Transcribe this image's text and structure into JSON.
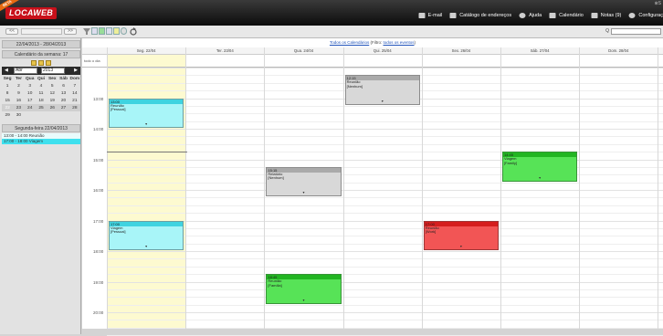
{
  "app": {
    "beta": "BETA",
    "logo": "LOCAWEB",
    "close_glyph": "⊗S"
  },
  "topnav": [
    {
      "label": "E-mail",
      "icon": "email-icon"
    },
    {
      "label": "Catálogo de endereços",
      "icon": "contacts-icon"
    },
    {
      "label": "Ajuda",
      "icon": "help-icon"
    },
    {
      "label": "Calendário",
      "icon": "calendar-icon"
    },
    {
      "label": "Notas (9)",
      "icon": "notes-icon"
    },
    {
      "label": "Configuraç",
      "icon": "gear-icon"
    }
  ],
  "toolbar": {
    "prev": "<<",
    "next": ">>",
    "search_label": "Q"
  },
  "left": {
    "range": "22/04/2013 - 28/04/2013",
    "week_title": "Calendário da semana: 17",
    "month": "Abr",
    "year": "2013",
    "weekdays": [
      "Seg",
      "Ter",
      "Qua",
      "Qui",
      "Sex",
      "Sáb",
      "Dom"
    ],
    "weeks": [
      [
        "1",
        "2",
        "3",
        "4",
        "5",
        "6",
        "7"
      ],
      [
        "8",
        "9",
        "10",
        "11",
        "12",
        "13",
        "14"
      ],
      [
        "15",
        "16",
        "17",
        "18",
        "19",
        "20",
        "21"
      ],
      [
        "22",
        "23",
        "24",
        "25",
        "26",
        "27",
        "28"
      ],
      [
        "29",
        "30",
        "",
        "",
        "",
        "",
        ""
      ]
    ],
    "day_title": "Segunda-feira 22/04/2013",
    "day_events": [
      "13:00 - 14:00 Reunião",
      "17:00 - 18:00 Viagem"
    ]
  },
  "main": {
    "cal_link": "Todos os Calendários",
    "filter_label": "(Filtro:",
    "filter_link": "todos os eventos",
    "filter_end": ")",
    "allday_label": "todo o dia",
    "days": [
      "Seg. 22/04",
      "Ter. 23/04",
      "Qua. 24/04",
      "Qui. 25/04",
      "Sex. 26/04",
      "Sáb. 27/04",
      "Dom. 28/04"
    ],
    "hours": [
      "13:00",
      "14:00",
      "15:00",
      "16:00",
      "17:00",
      "18:00",
      "19:00",
      "20:00"
    ]
  },
  "events": [
    {
      "day": 0,
      "start": 13.0,
      "time": "13:00",
      "title": "Reunião",
      "cal": "[Pessoal]",
      "color": "#a8f5f8",
      "head": "#3fd3e0"
    },
    {
      "day": 0,
      "start": 17.0,
      "time": "17:00",
      "title": "Viagem",
      "cal": "[Pessoal]",
      "color": "#a8f5f8",
      "head": "#3fd3e0"
    },
    {
      "day": 2,
      "start": 15.25,
      "time": "15:15",
      "title": "Relatório",
      "cal": "[Nenhum]",
      "color": "#d8d8d8",
      "head": "#aaaaaa"
    },
    {
      "day": 2,
      "start": 18.75,
      "time": "18:45",
      "title": "Reunião",
      "cal": "[Família]",
      "color": "#57e357",
      "head": "#22b522"
    },
    {
      "day": 3,
      "start": 12.25,
      "time": "12:15",
      "title": "Reunião",
      "cal": "[Nenhum]",
      "color": "#d8d8d8",
      "head": "#aaaaaa"
    },
    {
      "day": 4,
      "start": 17.0,
      "time": "17:00",
      "title": "Reunião",
      "cal": "[Work]",
      "color": "#f25555",
      "head": "#d51e1e"
    },
    {
      "day": 5,
      "start": 14.75,
      "time": "14:45",
      "title": "Viagem",
      "cal": "[Family]",
      "color": "#57e357",
      "head": "#22b522"
    }
  ]
}
